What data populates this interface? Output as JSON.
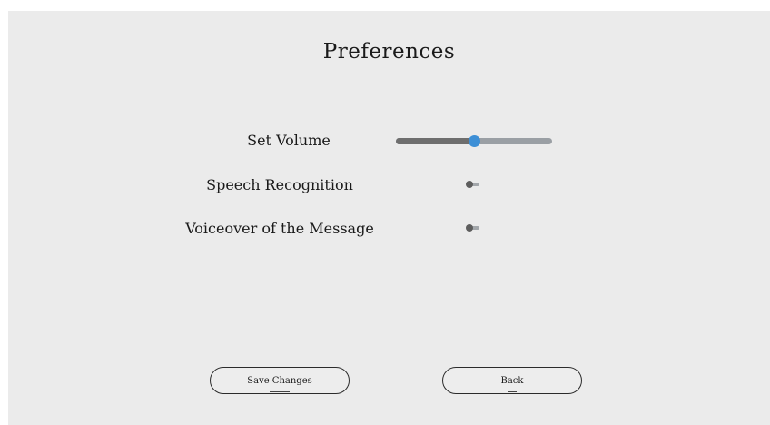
{
  "window": {
    "title": "Preferences"
  },
  "settings": {
    "volume": {
      "label": "Set Volume",
      "value_fraction": 0.5
    },
    "speech_recognition": {
      "label": "Speech Recognition",
      "enabled": false
    },
    "voiceover": {
      "label": "Voiceover of the Message",
      "enabled": false
    }
  },
  "buttons": {
    "save_label": "Save Changes",
    "back_label": "Back"
  },
  "colors": {
    "background": "#ebebeb",
    "slider_accent": "#3d8fd6",
    "slider_filled": "#6e6e6e",
    "slider_track": "#9a9fa4",
    "toggle_knob": "#5d5d5d"
  }
}
